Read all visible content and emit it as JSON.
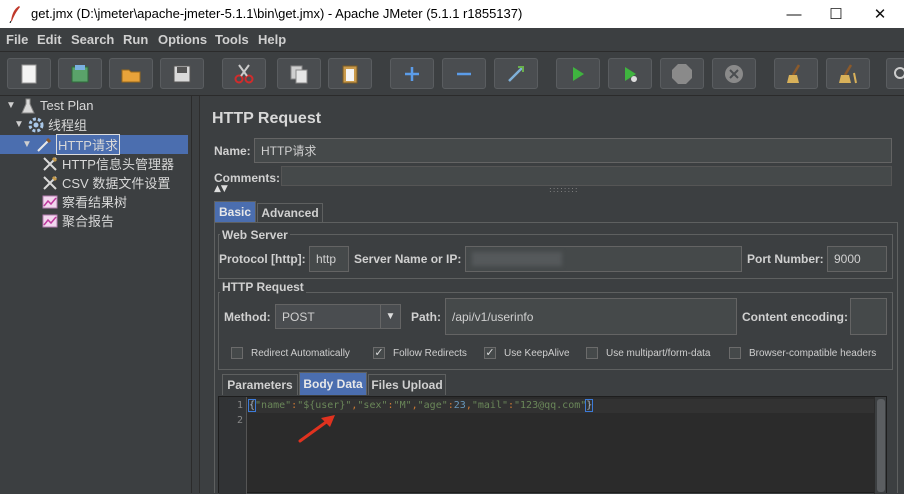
{
  "window": {
    "title": "get.jmx (D:\\jmeter\\apache-jmeter-5.1.1\\bin\\get.jmx) - Apache JMeter (5.1.1 r1855137)",
    "minimize": "—",
    "maximize": "☐",
    "close": "✕"
  },
  "menu": {
    "items": [
      "File",
      "Edit",
      "Search",
      "Run",
      "Options",
      "Tools",
      "Help"
    ]
  },
  "toolbar": {
    "buttons": [
      "new",
      "templates",
      "open",
      "save",
      "cut",
      "copy",
      "paste",
      "expand",
      "collapse",
      "toggle",
      "start",
      "start-no-pauses",
      "stop",
      "shutdown",
      "clear",
      "clear-all",
      "search"
    ]
  },
  "tree": {
    "items": [
      {
        "label": "Test Plan",
        "icon": "test-plan-icon"
      },
      {
        "label": "线程组",
        "icon": "gear-icon"
      },
      {
        "label": "HTTP请求",
        "icon": "pipette-icon",
        "selected": true
      },
      {
        "label": "HTTP信息头管理器",
        "icon": "wrench-icon"
      },
      {
        "label": "CSV 数据文件设置",
        "icon": "wrench-icon"
      },
      {
        "label": "察看结果树",
        "icon": "chart-icon"
      },
      {
        "label": "聚合报告",
        "icon": "chart-icon"
      }
    ]
  },
  "panel": {
    "title": "HTTP Request",
    "name_label": "Name:",
    "name_value": "HTTP请求",
    "comments_label": "Comments:",
    "tabs": [
      "Basic",
      "Advanced"
    ],
    "web_server": {
      "title": "Web Server",
      "protocol_label": "Protocol [http]:",
      "protocol_value": "http",
      "server_label": "Server Name or IP:",
      "server_value": "",
      "port_label": "Port Number:",
      "port_value": "9000"
    },
    "http_request": {
      "title": "HTTP Request",
      "method_label": "Method:",
      "method_value": "POST",
      "path_label": "Path:",
      "path_value": "/api/v1/userinfo",
      "encoding_label": "Content encoding:",
      "encoding_value": ""
    },
    "options": [
      {
        "label": "Redirect Automatically",
        "checked": false
      },
      {
        "label": "Follow Redirects",
        "checked": true
      },
      {
        "label": "Use KeepAlive",
        "checked": true
      },
      {
        "label": "Use multipart/form-data",
        "checked": false
      },
      {
        "label": "Browser-compatible headers",
        "checked": false
      }
    ],
    "body_tabs": [
      "Parameters",
      "Body Data",
      "Files Upload"
    ],
    "editor": {
      "line_numbers": [
        "1",
        "2"
      ],
      "line1": {
        "open_brace": "{",
        "k1": "\"name\"",
        "v1": "\"${user}\"",
        "k2": "\"sex\"",
        "v2": "\"M\"",
        "k3": "\"age\"",
        "v3": "23",
        "k4": "\"mail\"",
        "v4": "\"123@qq.com\"",
        "close_brace": "}",
        "colon": ":",
        "comma": ","
      }
    }
  },
  "colors": {
    "accent": "#4b6eaf",
    "string": "#6a8759",
    "number": "#6897bb",
    "annotation_arrow": "#e0321f"
  }
}
